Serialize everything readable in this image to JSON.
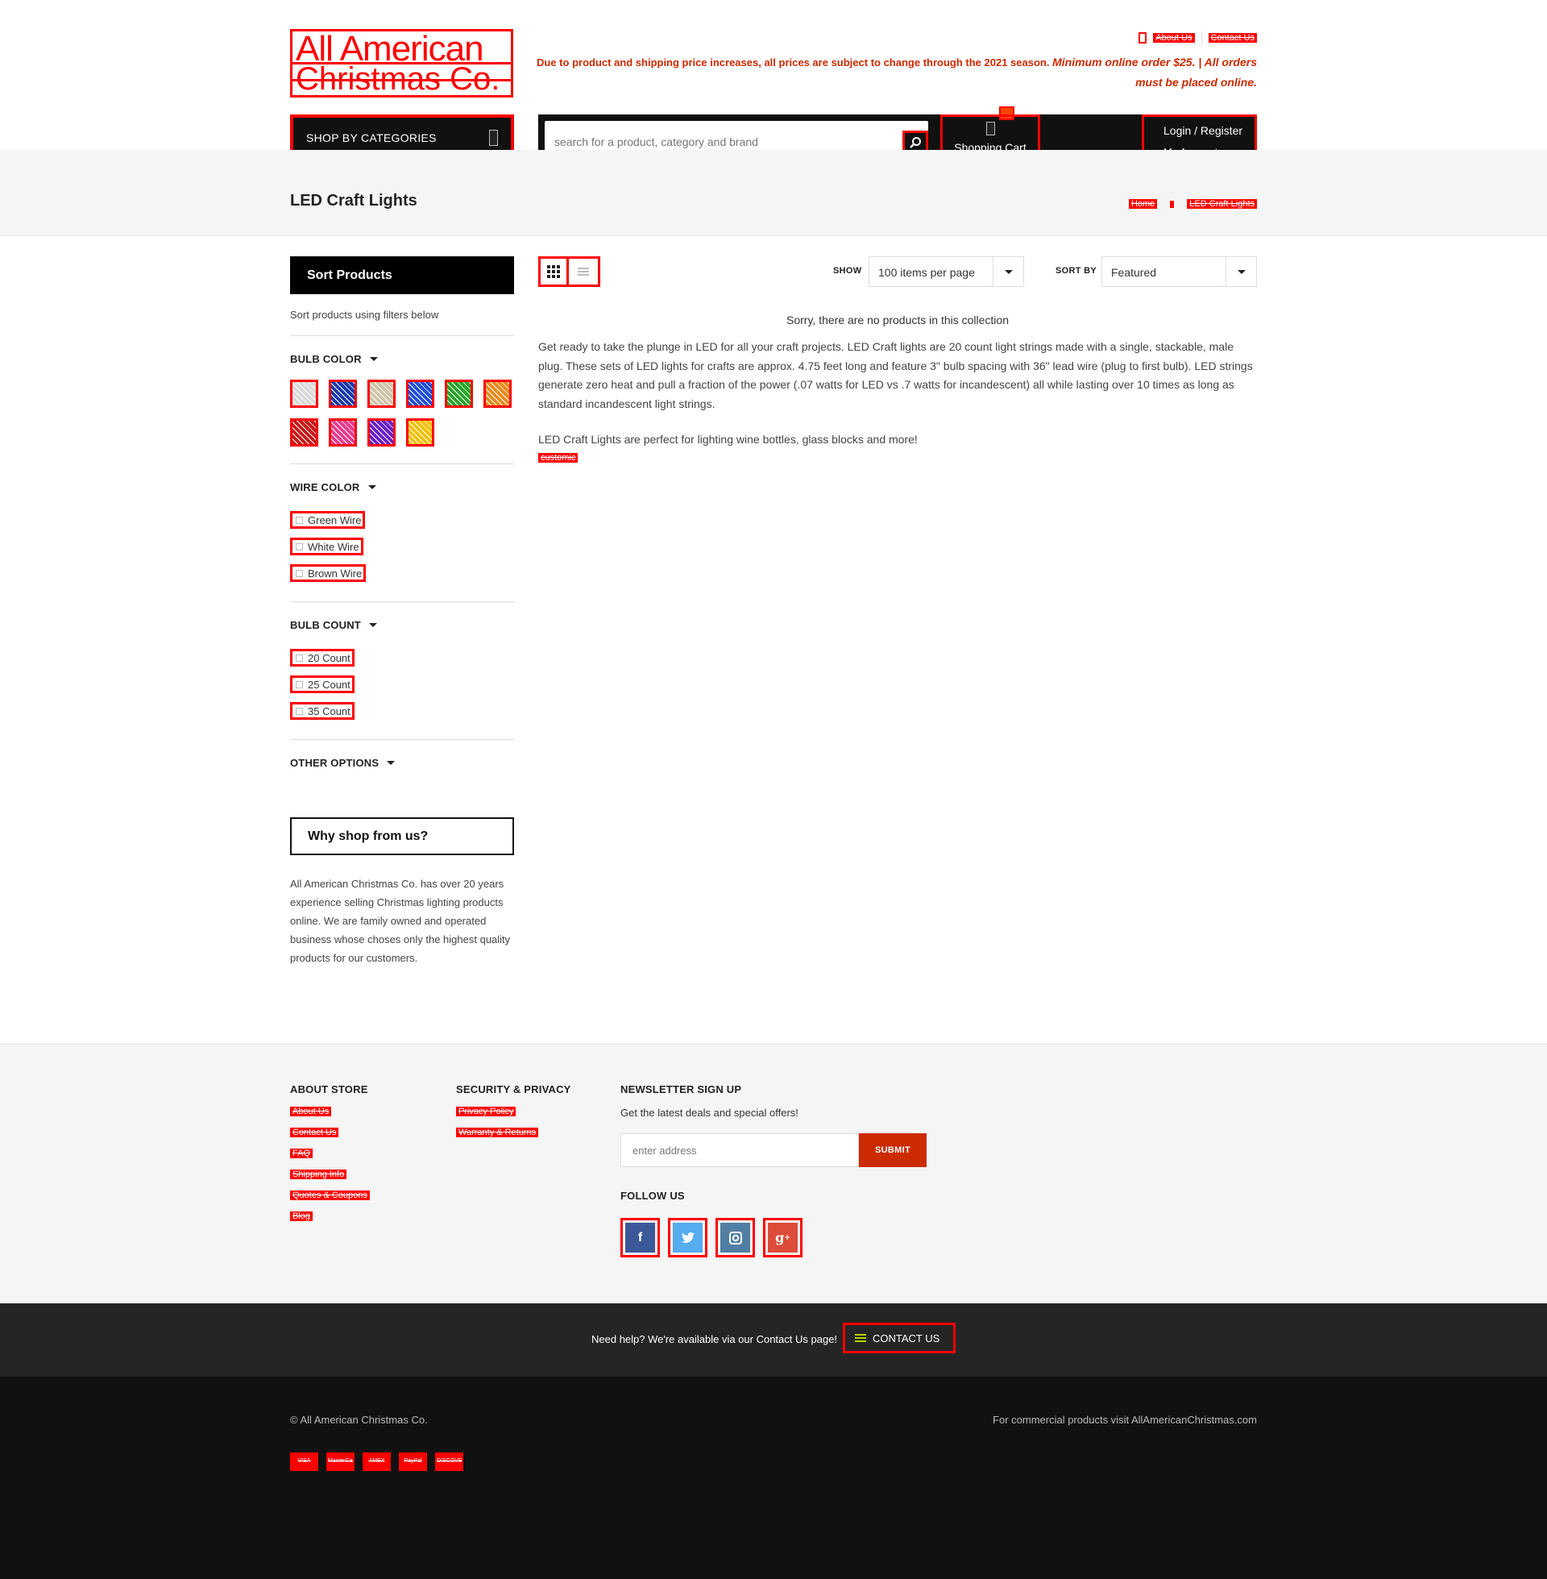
{
  "header": {
    "logo_line1": "All American",
    "logo_line2": "Christmas Co.",
    "top_links": [
      "About Us",
      "Contact Us"
    ],
    "notice_text": "Due to product and shipping price increases, all prices are subject to change through the 2021 season.",
    "notice_emphasis": "Minimum online order $25. | All orders must be placed online.",
    "shop_by_categories": "SHOP BY CATEGORIES",
    "search_placeholder": "search for a product, category and brand",
    "cart_label": "Shopping Cart",
    "login_label": "Login / Register",
    "account_label": "My Account"
  },
  "page": {
    "title": "LED Craft Lights",
    "breadcrumb": [
      "Home",
      "LED Craft Lights"
    ]
  },
  "sidebar": {
    "sort_title": "Sort Products",
    "sort_note": "Sort products using filters below",
    "bulb_color_title": "BULB COLOR",
    "bulb_colors": [
      {
        "name": "Cool White",
        "color": "#d9d9d9"
      },
      {
        "name": "Multicolor",
        "color": "#1a3aa8"
      },
      {
        "name": "Warm White",
        "color": "#cfc4a8"
      },
      {
        "name": "Blue",
        "color": "#1f4fd6"
      },
      {
        "name": "Green",
        "color": "#28a428"
      },
      {
        "name": "Orange",
        "color": "#e88a1c"
      },
      {
        "name": "Red",
        "color": "#c41a1a"
      },
      {
        "name": "Pink",
        "color": "#e83a8c"
      },
      {
        "name": "Purple",
        "color": "#6a1fc8"
      },
      {
        "name": "Yellow",
        "color": "#f0c000"
      }
    ],
    "wire_color_title": "WIRE COLOR",
    "wire_colors": [
      "Green Wire",
      "White Wire",
      "Brown Wire"
    ],
    "bulb_count_title": "BULB COUNT",
    "bulb_counts": [
      "20 Count",
      "25 Count",
      "35 Count"
    ],
    "other_options_title": "OTHER OPTIONS",
    "why_title": "Why shop from us?",
    "why_text": "All American Christmas Co. has over 20 years experience selling Christmas lighting products online. We are family owned and operated business whose choses only the highest quality products for our customers."
  },
  "toolbar": {
    "show_label": "SHOW",
    "show_value": "100 items per page",
    "sort_label": "SORT BY",
    "sort_value": "Featured"
  },
  "main": {
    "empty_message": "Sorry, there are no products in this collection",
    "description_1": "Get ready to take the plunge in LED for all your craft projects. LED Craft lights are 20 count light strings made with a single, stackable, male plug. These sets of LED lights for crafts are approx. 4.75 feet long and feature 3\" bulb spacing with 36\" lead wire (plug to first bulb). LED strings generate zero heat and pull a fraction of the power (.07 watts for LED vs .7 watts for incandescent) all while lasting over 10 times as long as standard incandescent light strings.",
    "description_2": "LED Craft Lights are perfect for lighting wine bottles, glass blocks and more!",
    "description_link": "customic"
  },
  "footer": {
    "about_title": "ABOUT STORE",
    "about_links": [
      "About Us",
      "Contact Us",
      "FAQ",
      "Shipping Info",
      "Quotes & Coupons",
      "Blog"
    ],
    "security_title": "SECURITY & PRIVACY",
    "security_links": [
      "Privacy Policy",
      "Warranty & Returns"
    ],
    "newsletter_title": "NEWSLETTER SIGN UP",
    "newsletter_text": "Get the latest deals and special offers!",
    "newsletter_placeholder": "enter address",
    "newsletter_submit": "SUBMIT",
    "follow_title": "FOLLOW US",
    "socials": [
      {
        "name": "facebook",
        "glyph": "f",
        "color": "#3b5998"
      },
      {
        "name": "twitter",
        "glyph": "t",
        "color": "#55acee"
      },
      {
        "name": "instagram",
        "glyph": "ig",
        "color": "#517fa4"
      },
      {
        "name": "google-plus",
        "glyph": "g+",
        "color": "#dd4b39"
      }
    ],
    "help_text": "Need help? We're available via our Contact Us page!",
    "contact_button": "CONTACT US",
    "copyright": "© All American Christmas Co.",
    "commercial": "For commercial products visit AllAmericanChristmas.com",
    "payments": [
      "VISA",
      "MasterCard",
      "AMEX",
      "PayPal",
      "DISCOVER"
    ]
  }
}
